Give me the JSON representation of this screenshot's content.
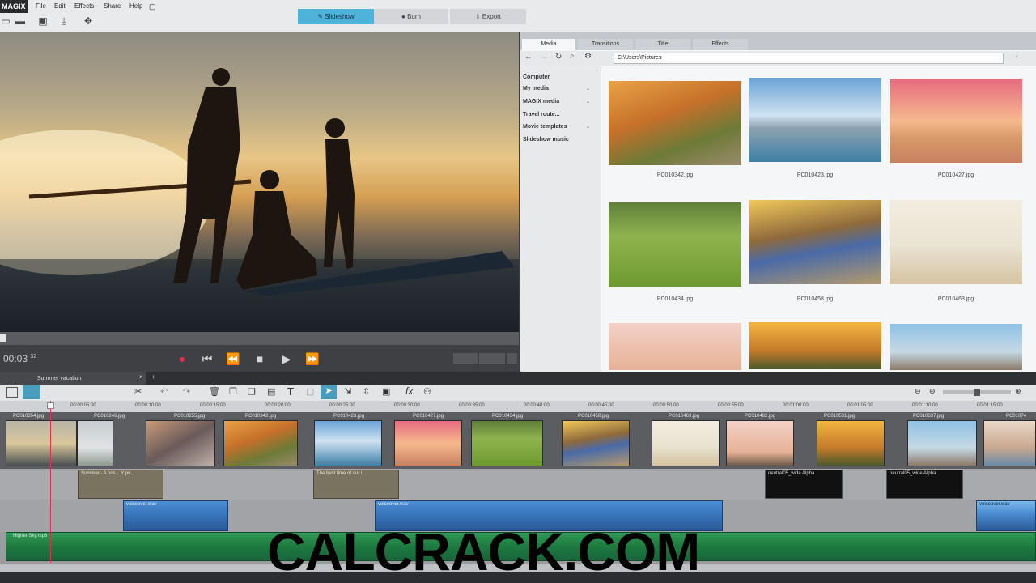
{
  "app": {
    "logo": "MAGIX"
  },
  "menu": [
    "File",
    "Edit",
    "Effects",
    "Share",
    "Help"
  ],
  "modes": {
    "slideshow": "Slideshow",
    "burn": "Burn",
    "export": "Export"
  },
  "preview": {
    "timecode": "00:03",
    "frame": "32"
  },
  "browser": {
    "tabs": [
      "Media",
      "Transitions",
      "Title",
      "Effects"
    ],
    "path": "C:\\Users\\Pictures",
    "sidebar": [
      "Computer",
      "My media",
      "MAGIX media",
      "Travel route...",
      "Movie templates",
      "Slideshow music"
    ],
    "files": [
      "PC010342.jpg",
      "PC010423.jpg",
      "PC010427.jpg",
      "PC010434.jpg",
      "PC010458.jpg",
      "PC010463.jpg",
      "",
      "",
      ""
    ]
  },
  "timeline": {
    "project_tab": "Summer vacation",
    "ruler": [
      "00:00:05:00",
      "00:00:10:00",
      "00:00:15:00",
      "00:00:20:00",
      "00:00:25:00",
      "00:00:30:00",
      "00:00:35:00",
      "00:00:40:00",
      "00:00:45:00",
      "00:00:50:00",
      "00:00:55:00",
      "00:01:00:00",
      "00:01:05:00",
      "00:01:10:00",
      "00:01:15:00"
    ],
    "photo_clips": [
      "PC010354.jpg",
      "PC010246.jpg",
      "PC010255.jpg",
      "PC010342.jpg",
      "PC010423.jpg",
      "PC010427.jpg",
      "PC010434.jpg",
      "PC010458.jpg",
      "PC010463.jpg",
      "PC010482.jpg",
      "PC010531.jpg",
      "PC010637.jpg",
      "PC01074"
    ],
    "title_clips": [
      "Summer - A pos... Y pu...",
      "The best time of our l...",
      "neutral05_wide Alpha",
      "neutral05_wide Alpha"
    ],
    "audio_clips": [
      "voiceover.wav",
      "voiceover.wav",
      "voiceover.wav"
    ],
    "music": "Higher Sky.mp3"
  },
  "watermark": "CALCRACK.COM"
}
